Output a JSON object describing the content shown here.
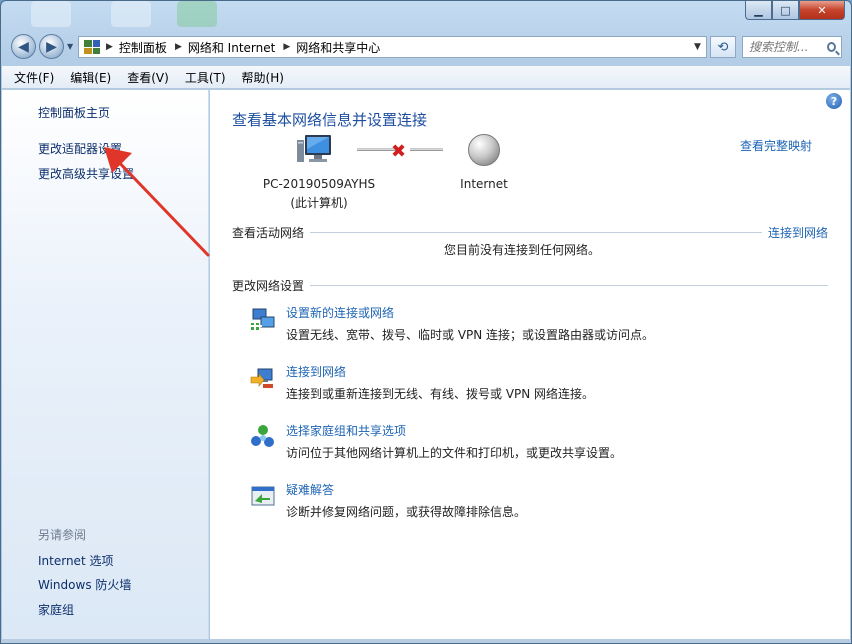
{
  "window": {
    "controls": {
      "minimize": "▁",
      "maximize": "□",
      "close": "✕"
    }
  },
  "address_bar": {
    "crumbs": [
      "控制面板",
      "网络和 Internet",
      "网络和共享中心"
    ],
    "search_placeholder": "搜索控制...",
    "back_icon": "back-arrow-icon",
    "forward_icon": "forward-arrow-icon"
  },
  "menu": [
    "文件(F)",
    "编辑(E)",
    "查看(V)",
    "工具(T)",
    "帮助(H)"
  ],
  "sidebar": {
    "links": [
      "控制面板主页",
      "更改适配器设置",
      "更改高级共享设置"
    ],
    "see_also_heading": "另请参阅",
    "see_also": [
      "Internet 选项",
      "Windows 防火墙",
      "家庭组"
    ]
  },
  "main": {
    "title": "查看基本网络信息并设置连接",
    "full_map_link": "查看完整映射",
    "computer_name": "PC-20190509AYHS",
    "computer_sub": "(此计算机)",
    "internet_label": "Internet",
    "active_networks_label": "查看活动网络",
    "connect_link": "连接到网络",
    "no_connection_text": "您目前没有连接到任何网络。",
    "change_settings_label": "更改网络设置",
    "tasks": [
      {
        "title": "设置新的连接或网络",
        "desc": "设置无线、宽带、拨号、临时或 VPN 连接；或设置路由器或访问点。",
        "icon": "new-connection-icon"
      },
      {
        "title": "连接到网络",
        "desc": "连接到或重新连接到无线、有线、拨号或 VPN 网络连接。",
        "icon": "connect-network-icon"
      },
      {
        "title": "选择家庭组和共享选项",
        "desc": "访问位于其他网络计算机上的文件和打印机，或更改共享设置。",
        "icon": "homegroup-icon"
      },
      {
        "title": "疑难解答",
        "desc": "诊断并修复网络问题，或获得故障排除信息。",
        "icon": "troubleshoot-icon"
      }
    ]
  },
  "colors": {
    "link": "#1e64b4",
    "title": "#1e4fa0",
    "annotation_arrow": "#e0362a",
    "disconnect_x": "#d11d1d"
  }
}
